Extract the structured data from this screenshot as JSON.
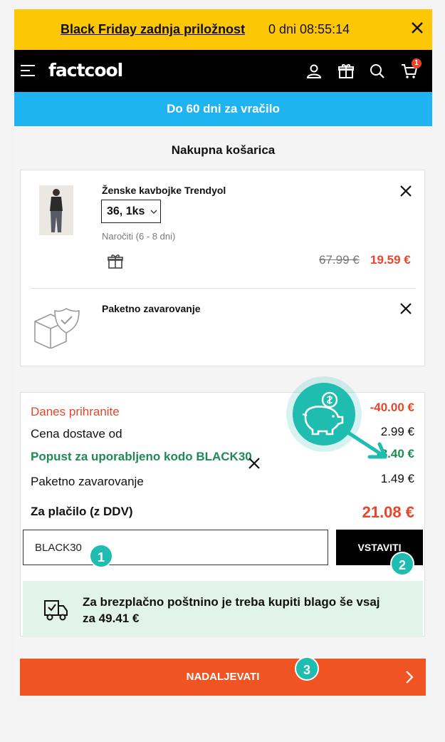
{
  "promo": {
    "link": "Black Friday zadnja priložnost",
    "timer": "0 dni 08:55:14"
  },
  "header": {
    "logo": "factcool",
    "cart_count": "1"
  },
  "returns_banner": "Do 60 dni za vračilo",
  "page_title": "Nakupna košarica",
  "cart_items": [
    {
      "name": "Ženske kavbojke Trendyol",
      "size": "36, 1ks",
      "delivery": "Naročiti (6 - 8 dni)",
      "old_price": "67.99 €",
      "price": "19.59 €"
    },
    {
      "name": "Paketno zavarovanje"
    }
  ],
  "summary": {
    "savings_label": "Danes prihranite",
    "savings_value": "-40.00 €",
    "shipping_label": "Cena dostave od",
    "shipping_value": "2.99 €",
    "coupon_label": "Popust za uporabljeno kodo BLACK30",
    "coupon_value": "-8.40 €",
    "insurance_label": "Paketno zavarovanje",
    "insurance_value": "1.49 €",
    "total_label": "Za plačilo (z DDV)",
    "total_value": "21.08 €"
  },
  "coupon": {
    "value": "BLACK30",
    "apply_label": "VSTAVITI"
  },
  "free_shipping": "Za brezplačno poštnino je treba kupiti blago še vsaj za 49.41 €",
  "checkout_label": "NADALJEVATI",
  "steps": [
    "1",
    "2",
    "3"
  ],
  "colors": {
    "promo_yellow": "#fec705",
    "info_blue": "#20b3f2",
    "accent_red": "#e8452a",
    "discount_green": "#1f8a53",
    "checkout_orange": "#f05423",
    "teal_marker": "#1fbcb0",
    "free_ship_bg": "#e1f3ea"
  }
}
